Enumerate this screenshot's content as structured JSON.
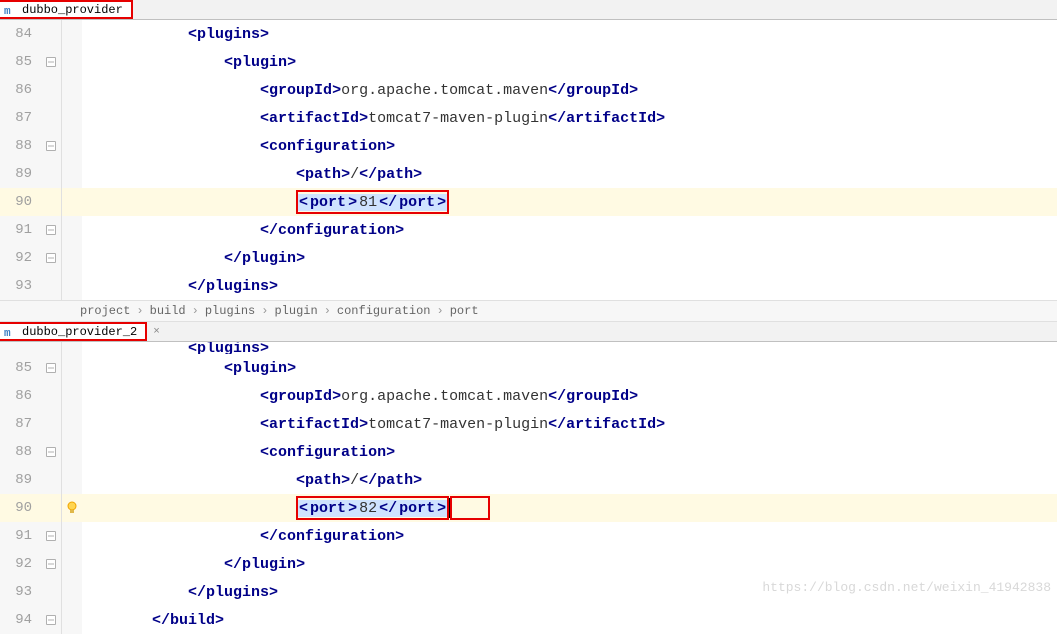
{
  "panes": [
    {
      "tab": {
        "label": "dubbo_provider",
        "highlighted": true
      },
      "lines": [
        {
          "num": "84",
          "indent": 2,
          "fold": false,
          "hl": false,
          "tokens": [
            {
              "t": "br",
              "v": "<"
            },
            {
              "t": "tag",
              "v": "plugins"
            },
            {
              "t": "br",
              "v": ">"
            }
          ]
        },
        {
          "num": "85",
          "indent": 3,
          "fold": true,
          "hl": false,
          "tokens": [
            {
              "t": "br",
              "v": "<"
            },
            {
              "t": "tag",
              "v": "plugin"
            },
            {
              "t": "br",
              "v": ">"
            }
          ]
        },
        {
          "num": "86",
          "indent": 4,
          "fold": false,
          "hl": false,
          "tokens": [
            {
              "t": "br",
              "v": "<"
            },
            {
              "t": "tag",
              "v": "groupId"
            },
            {
              "t": "br",
              "v": ">"
            },
            {
              "t": "txt",
              "v": "org.apache.tomcat.maven"
            },
            {
              "t": "br",
              "v": "</"
            },
            {
              "t": "tag",
              "v": "groupId"
            },
            {
              "t": "br",
              "v": ">"
            }
          ]
        },
        {
          "num": "87",
          "indent": 4,
          "fold": false,
          "hl": false,
          "tokens": [
            {
              "t": "br",
              "v": "<"
            },
            {
              "t": "tag",
              "v": "artifactId"
            },
            {
              "t": "br",
              "v": ">"
            },
            {
              "t": "txt",
              "v": "tomcat7-maven-plugin"
            },
            {
              "t": "br",
              "v": "</"
            },
            {
              "t": "tag",
              "v": "artifactId"
            },
            {
              "t": "br",
              "v": ">"
            }
          ]
        },
        {
          "num": "88",
          "indent": 4,
          "fold": true,
          "hl": false,
          "tokens": [
            {
              "t": "br",
              "v": "<"
            },
            {
              "t": "tag",
              "v": "configuration"
            },
            {
              "t": "br",
              "v": ">"
            }
          ]
        },
        {
          "num": "89",
          "indent": 5,
          "fold": false,
          "hl": false,
          "tokens": [
            {
              "t": "br",
              "v": "<"
            },
            {
              "t": "tag",
              "v": "path"
            },
            {
              "t": "br",
              "v": ">"
            },
            {
              "t": "txt",
              "v": "/"
            },
            {
              "t": "br",
              "v": "</"
            },
            {
              "t": "tag",
              "v": "path"
            },
            {
              "t": "br",
              "v": ">"
            }
          ]
        },
        {
          "num": "90",
          "indent": 5,
          "fold": false,
          "hl": true,
          "redbox": true,
          "sel": true,
          "tokens": [
            {
              "t": "br",
              "v": "<"
            },
            {
              "t": "tag",
              "v": "port"
            },
            {
              "t": "br",
              "v": ">"
            },
            {
              "t": "txt",
              "v": "81"
            },
            {
              "t": "br",
              "v": "</"
            },
            {
              "t": "tag",
              "v": "port"
            },
            {
              "t": "br",
              "v": ">"
            }
          ]
        },
        {
          "num": "91",
          "indent": 4,
          "fold": true,
          "hl": false,
          "tokens": [
            {
              "t": "br",
              "v": "</"
            },
            {
              "t": "tag",
              "v": "configuration"
            },
            {
              "t": "br",
              "v": ">"
            }
          ]
        },
        {
          "num": "92",
          "indent": 3,
          "fold": true,
          "hl": false,
          "tokens": [
            {
              "t": "br",
              "v": "</"
            },
            {
              "t": "tag",
              "v": "plugin"
            },
            {
              "t": "br",
              "v": ">"
            }
          ]
        },
        {
          "num": "93",
          "indent": 2,
          "fold": false,
          "hl": false,
          "tokens": [
            {
              "t": "br",
              "v": "</"
            },
            {
              "t": "tag",
              "v": "plugins"
            },
            {
              "t": "br",
              "v": ">"
            }
          ]
        }
      ],
      "breadcrumb": [
        "project",
        "build",
        "plugins",
        "plugin",
        "configuration",
        "port"
      ]
    },
    {
      "tab": {
        "label": "dubbo_provider_2",
        "highlighted": true
      },
      "lines": [
        {
          "num": "85",
          "indent": 3,
          "fold": true,
          "hl": false,
          "tokens": [
            {
              "t": "br",
              "v": "<"
            },
            {
              "t": "tag",
              "v": "plugin"
            },
            {
              "t": "br",
              "v": ">"
            }
          ]
        },
        {
          "num": "86",
          "indent": 4,
          "fold": false,
          "hl": false,
          "tokens": [
            {
              "t": "br",
              "v": "<"
            },
            {
              "t": "tag",
              "v": "groupId"
            },
            {
              "t": "br",
              "v": ">"
            },
            {
              "t": "txt",
              "v": "org.apache.tomcat.maven"
            },
            {
              "t": "br",
              "v": "</"
            },
            {
              "t": "tag",
              "v": "groupId"
            },
            {
              "t": "br",
              "v": ">"
            }
          ]
        },
        {
          "num": "87",
          "indent": 4,
          "fold": false,
          "hl": false,
          "tokens": [
            {
              "t": "br",
              "v": "<"
            },
            {
              "t": "tag",
              "v": "artifactId"
            },
            {
              "t": "br",
              "v": ">"
            },
            {
              "t": "txt",
              "v": "tomcat7-maven-plugin"
            },
            {
              "t": "br",
              "v": "</"
            },
            {
              "t": "tag",
              "v": "artifactId"
            },
            {
              "t": "br",
              "v": ">"
            }
          ]
        },
        {
          "num": "88",
          "indent": 4,
          "fold": true,
          "hl": false,
          "tokens": [
            {
              "t": "br",
              "v": "<"
            },
            {
              "t": "tag",
              "v": "configuration"
            },
            {
              "t": "br",
              "v": ">"
            }
          ]
        },
        {
          "num": "89",
          "indent": 5,
          "fold": false,
          "hl": false,
          "tokens": [
            {
              "t": "br",
              "v": "<"
            },
            {
              "t": "tag",
              "v": "path"
            },
            {
              "t": "br",
              "v": ">"
            },
            {
              "t": "txt",
              "v": "/"
            },
            {
              "t": "br",
              "v": "</"
            },
            {
              "t": "tag",
              "v": "path"
            },
            {
              "t": "br",
              "v": ">"
            }
          ]
        },
        {
          "num": "90",
          "indent": 5,
          "fold": false,
          "hl": true,
          "bulb": true,
          "redbox": true,
          "sel": true,
          "caret": true,
          "padbox": true,
          "tokens": [
            {
              "t": "br",
              "v": "<"
            },
            {
              "t": "tag",
              "v": "port"
            },
            {
              "t": "br",
              "v": ">"
            },
            {
              "t": "txt",
              "v": "82"
            },
            {
              "t": "br",
              "v": "</"
            },
            {
              "t": "tag",
              "v": "port"
            },
            {
              "t": "br",
              "v": ">"
            }
          ]
        },
        {
          "num": "91",
          "indent": 4,
          "fold": true,
          "hl": false,
          "tokens": [
            {
              "t": "br",
              "v": "</"
            },
            {
              "t": "tag",
              "v": "configuration"
            },
            {
              "t": "br",
              "v": ">"
            }
          ]
        },
        {
          "num": "92",
          "indent": 3,
          "fold": true,
          "hl": false,
          "tokens": [
            {
              "t": "br",
              "v": "</"
            },
            {
              "t": "tag",
              "v": "plugin"
            },
            {
              "t": "br",
              "v": ">"
            }
          ]
        },
        {
          "num": "93",
          "indent": 2,
          "fold": false,
          "hl": false,
          "tokens": [
            {
              "t": "br",
              "v": "</"
            },
            {
              "t": "tag",
              "v": "plugins"
            },
            {
              "t": "br",
              "v": ">"
            }
          ]
        },
        {
          "num": "94",
          "indent": 1,
          "fold": true,
          "hl": false,
          "tokens": [
            {
              "t": "br",
              "v": "</"
            },
            {
              "t": "tag",
              "v": "build"
            },
            {
              "t": "br",
              "v": ">"
            }
          ]
        }
      ]
    }
  ],
  "watermark": "https://blog.csdn.net/weixin_41942838",
  "partialTopLine": {
    "indent": 2,
    "tokens": [
      {
        "t": "br",
        "v": "<"
      },
      {
        "t": "tag",
        "v": "plugins"
      },
      {
        "t": "br",
        "v": ">"
      }
    ]
  },
  "indentUnit": "    ",
  "baseIndentPx": 34
}
